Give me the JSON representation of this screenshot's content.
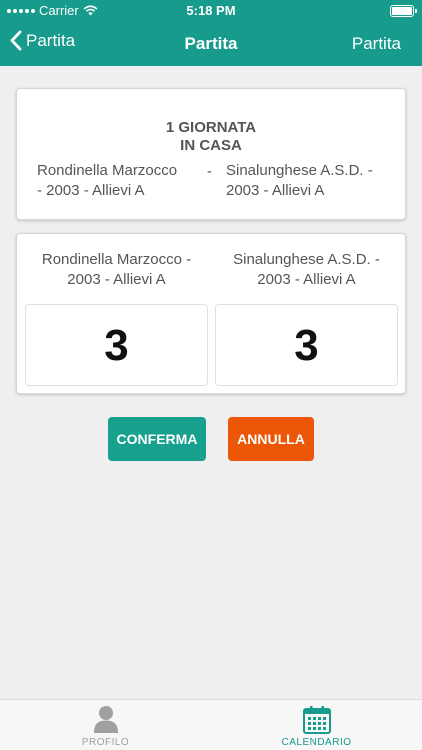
{
  "status_bar": {
    "carrier": "Carrier",
    "time": "5:18 PM"
  },
  "nav": {
    "back_label": "Partita",
    "title": "Partita",
    "right_label": "Partita"
  },
  "info_card": {
    "giornata_line1": "1 GIORNATA",
    "giornata_line2": "IN CASA",
    "home_team_line1": "Rondinella Marzocco",
    "home_team_line2": "- 2003 - Allievi A",
    "separator": "-",
    "away_team_line1": "Sinalunghese A.S.D. -",
    "away_team_line2": "2003 - Allievi A"
  },
  "score_card": {
    "home_team_line1": "Rondinella Marzocco -",
    "home_team_line2": "2003 - Allievi A",
    "away_team_line1": "Sinalunghese A.S.D. -",
    "away_team_line2": "2003 - Allievi A",
    "home_score": "3",
    "away_score": "3"
  },
  "buttons": {
    "confirm_label": "CONFERMA",
    "cancel_label": "ANNULLA"
  },
  "tabs": [
    {
      "label": "PROFILO",
      "icon": "person-icon",
      "active": false
    },
    {
      "label": "CALENDARIO",
      "icon": "calendar-icon",
      "active": true
    }
  ],
  "colors": {
    "primary": "#169b8c",
    "confirm": "#17a08d",
    "cancel": "#ec5607",
    "background": "#efefef"
  }
}
